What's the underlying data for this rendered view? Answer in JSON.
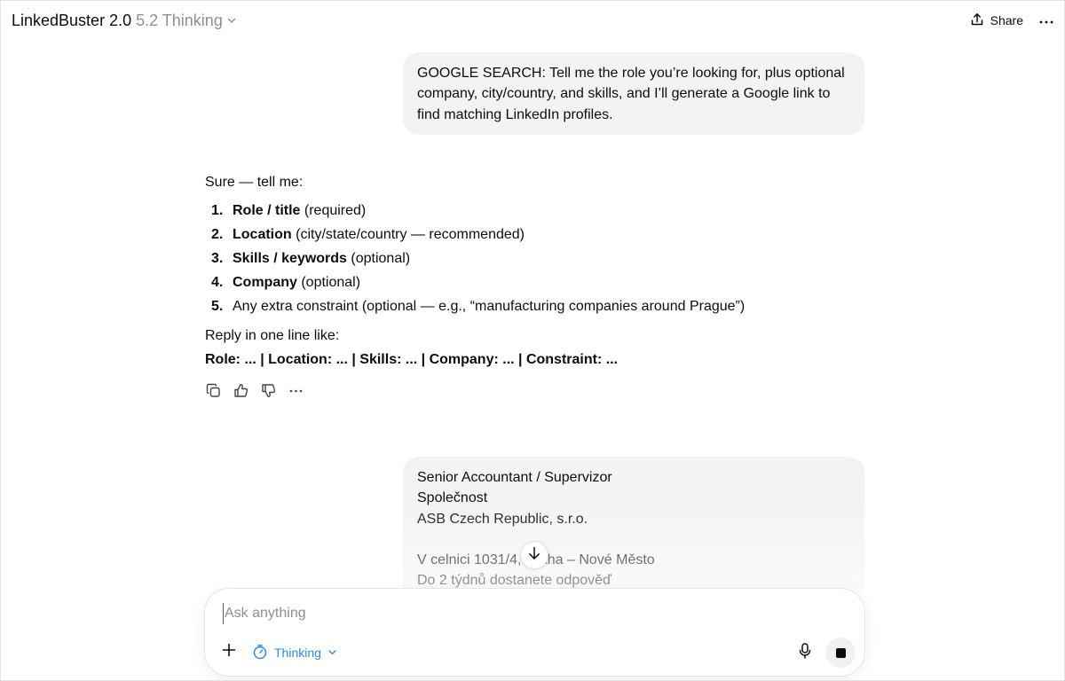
{
  "header": {
    "app_title": "LinkedBuster 2.0",
    "model_name": "5.2 Thinking",
    "share_label": "Share"
  },
  "messages": {
    "user_1": "GOOGLE SEARCH: Tell me the role you’re looking for, plus optional company, city/country, and skills, and I’ll generate a Google link to find matching LinkedIn profiles.",
    "assistant": {
      "intro": "Sure — tell me:",
      "steps": [
        {
          "num": "1.",
          "bold": "Role / title",
          "rest": " (required)"
        },
        {
          "num": "2.",
          "bold": "Location",
          "rest": " (city/state/country — recommended)"
        },
        {
          "num": "3.",
          "bold": "Skills / keywords",
          "rest": " (optional)"
        },
        {
          "num": "4.",
          "bold": "Company",
          "rest": " (optional)"
        },
        {
          "num": "5.",
          "bold": "",
          "rest": "Any extra constraint (optional — e.g., “manufacturing companies around Prague”)"
        }
      ],
      "reply_prompt": "Reply in one line like:",
      "template": "Role: ... | Location: ... | Skills: ... | Company: ... | Constraint: ..."
    },
    "user_2_lines": [
      "Senior Accountant / Supervizor",
      "Společnost",
      "ASB Czech Republic, s.r.o.",
      "",
      "V celnici 1031/4, Praha – Nové Město",
      "Do 2 týdnů dostanete odpověď"
    ]
  },
  "composer": {
    "placeholder": "Ask anything",
    "mode_label": "Thinking"
  },
  "colors": {
    "accent": "#2b8be6",
    "bubble": "#f3f3f3"
  }
}
